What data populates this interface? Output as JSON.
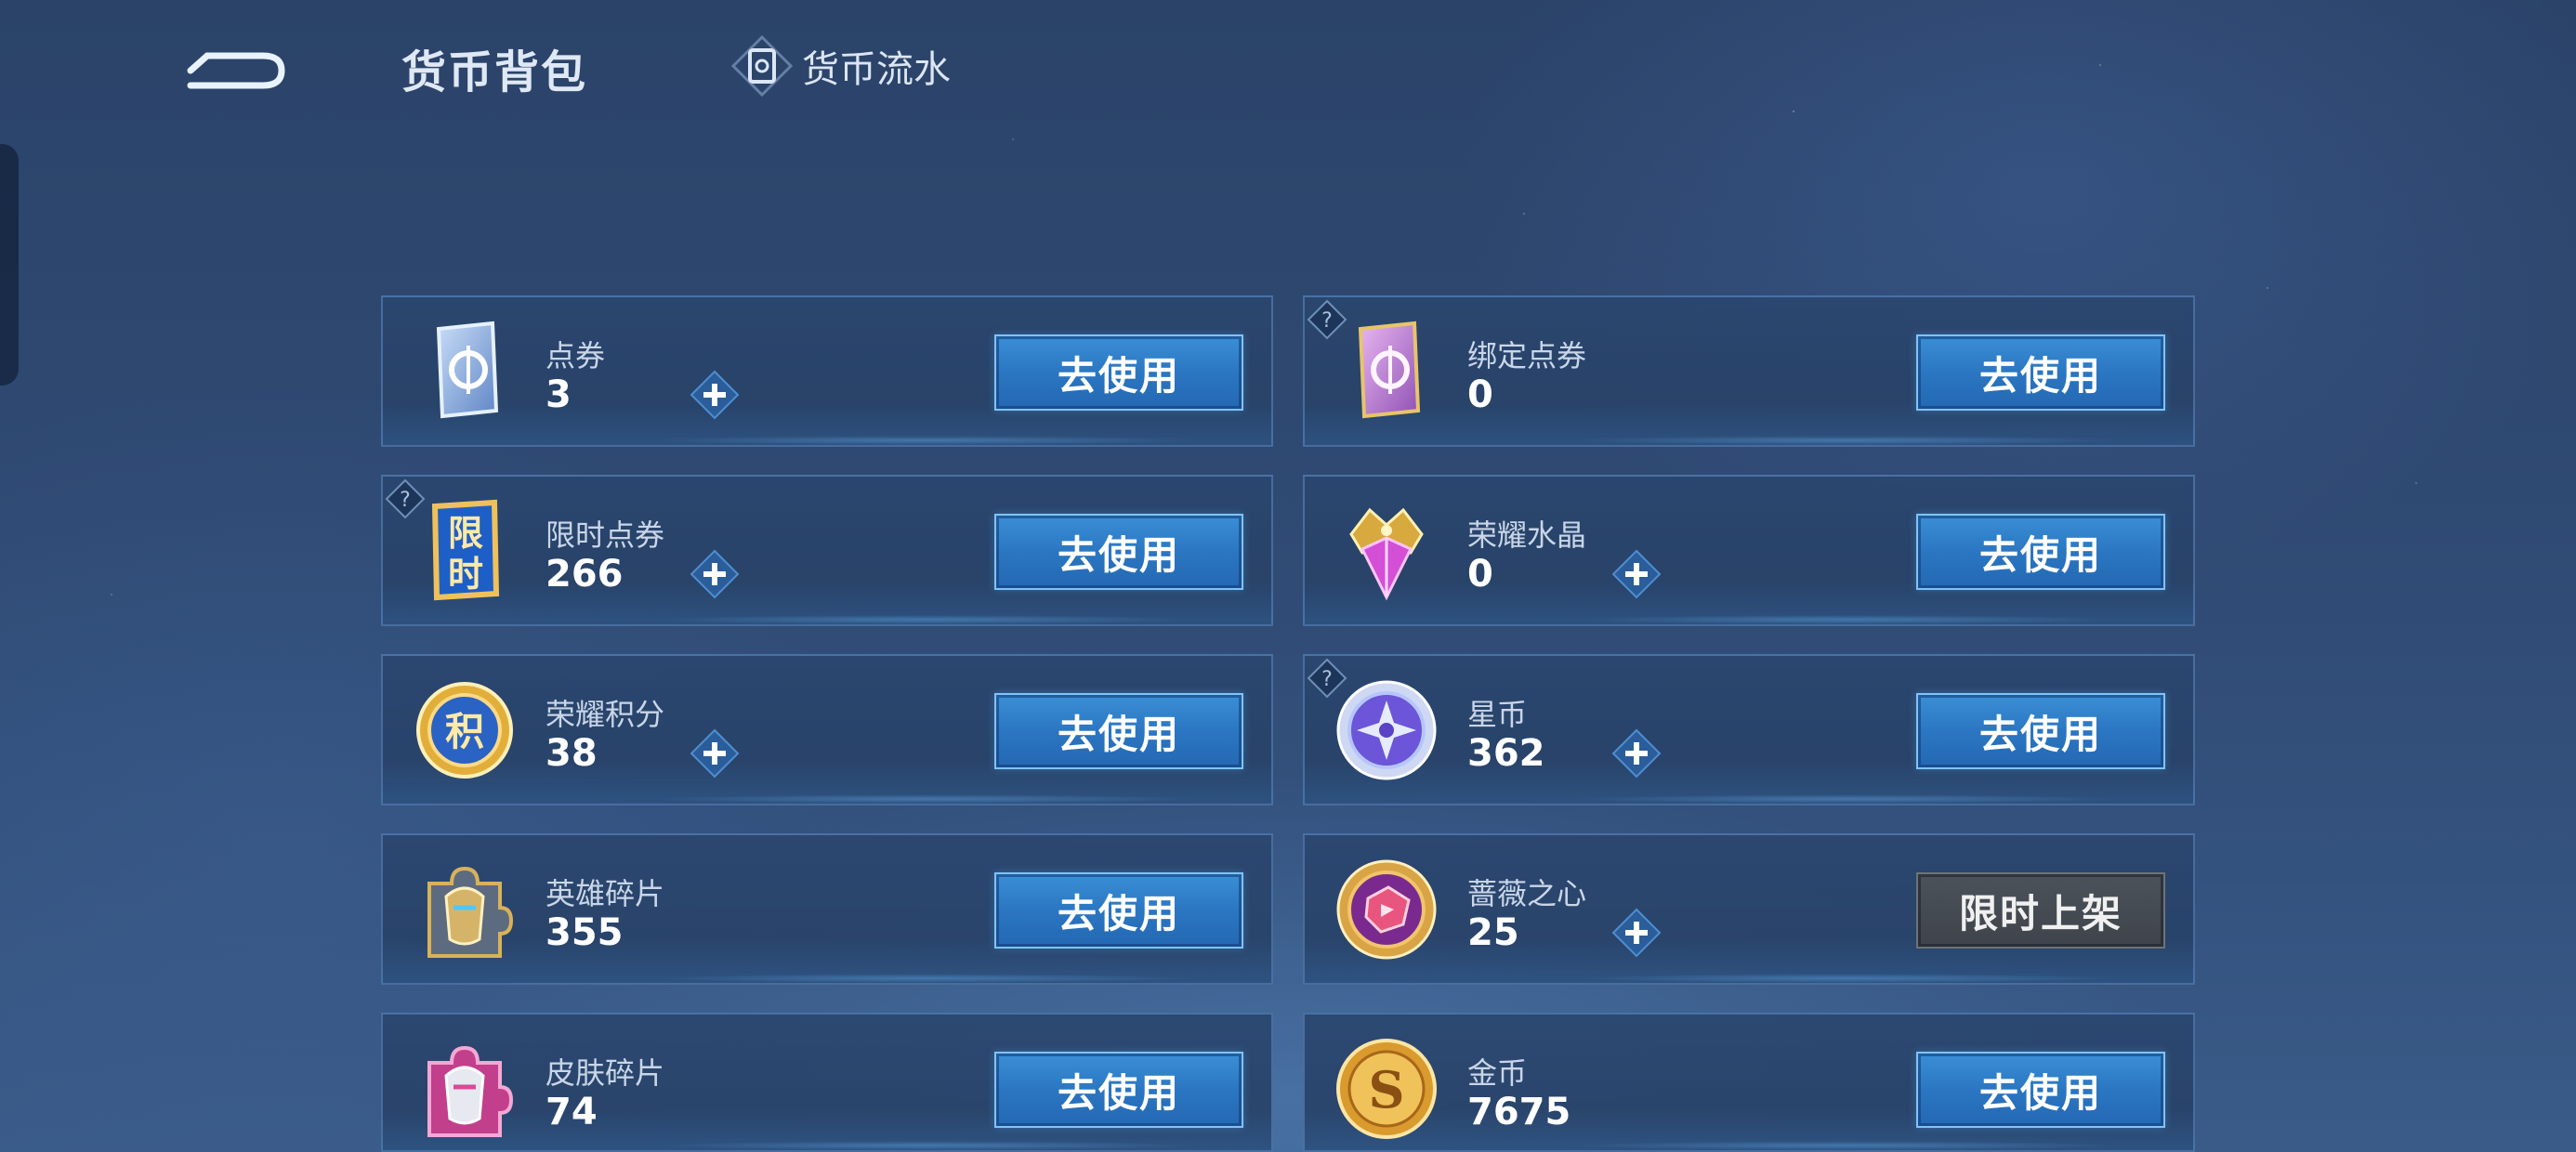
{
  "header": {
    "title": "货币背包",
    "flow_label": "货币流水"
  },
  "currencies": [
    {
      "name": "点券",
      "value": "3",
      "button": "去使用",
      "has_plus": true,
      "has_help": false
    },
    {
      "name": "绑定点券",
      "value": "0",
      "button": "去使用",
      "has_plus": false,
      "has_help": true
    },
    {
      "name": "限时点券",
      "value": "266",
      "button": "去使用",
      "has_plus": true,
      "has_help": true
    },
    {
      "name": "荣耀水晶",
      "value": "0",
      "button": "去使用",
      "has_plus": true,
      "has_help": false
    },
    {
      "name": "荣耀积分",
      "value": "38",
      "button": "去使用",
      "has_plus": true,
      "has_help": false
    },
    {
      "name": "星币",
      "value": "362",
      "button": "去使用",
      "has_plus": true,
      "has_help": true
    },
    {
      "name": "英雄碎片",
      "value": "355",
      "button": "去使用",
      "has_plus": false,
      "has_help": false
    },
    {
      "name": "蔷薇之心",
      "value": "25",
      "button": "限时上架",
      "has_plus": true,
      "has_help": false
    },
    {
      "name": "皮肤碎片",
      "value": "74",
      "button": "去使用",
      "has_plus": false,
      "has_help": false
    },
    {
      "name": "金币",
      "value": "7675",
      "button": "去使用",
      "has_plus": false,
      "has_help": false
    }
  ],
  "icon_text": {
    "limited_icon_top": "限",
    "limited_icon_bottom": "时",
    "points_icon": "积"
  },
  "colors": {
    "button_blue": "#2b76c2",
    "button_border": "#7ec4f7",
    "disabled_button": "#474c53",
    "background": "#2f4a73"
  }
}
